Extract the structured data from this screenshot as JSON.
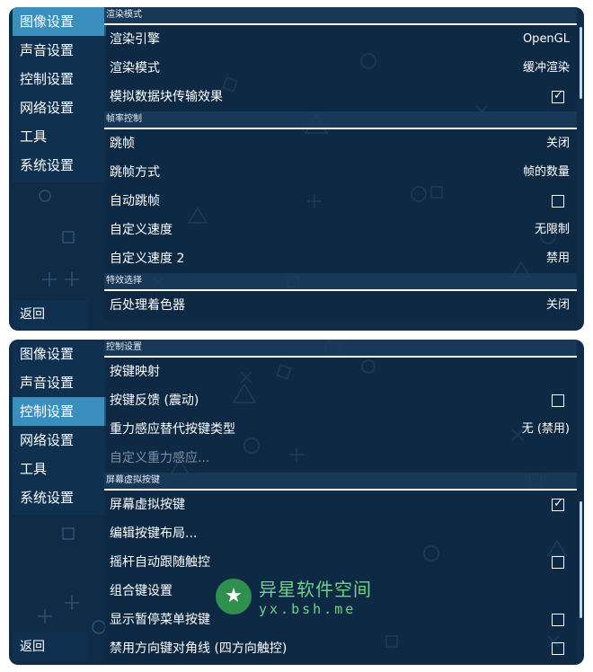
{
  "panel1": {
    "sidebar": [
      "图像设置",
      "声音设置",
      "控制设置",
      "网络设置",
      "工具",
      "系统设置"
    ],
    "active_index": 0,
    "back_label": "返回",
    "sections": [
      {
        "title": "渲染模式",
        "rows": [
          {
            "label": "渲染引擎",
            "value": "OpenGL"
          },
          {
            "label": "渲染模式",
            "value": "缓冲渲染"
          },
          {
            "label": "模拟数据块传输效果",
            "checkbox": true
          }
        ]
      },
      {
        "title": "帧率控制",
        "rows": [
          {
            "label": "跳帧",
            "value": "关闭"
          },
          {
            "label": "跳帧方式",
            "value": "帧的数量"
          },
          {
            "label": "自动跳帧",
            "checkbox": false
          },
          {
            "label": "自定义速度",
            "value": "无限制"
          },
          {
            "label": "自定义速度 2",
            "value": "禁用"
          }
        ]
      },
      {
        "title": "特效选择",
        "rows": [
          {
            "label": "后处理着色器",
            "value": "关闭"
          }
        ]
      }
    ]
  },
  "panel2": {
    "sidebar": [
      "图像设置",
      "声音设置",
      "控制设置",
      "网络设置",
      "工具",
      "系统设置"
    ],
    "active_index": 2,
    "back_label": "返回",
    "sections": [
      {
        "title": "控制设置",
        "rows": [
          {
            "label": "按键映射"
          },
          {
            "label": "按键反馈 (震动)",
            "checkbox": false
          },
          {
            "label": "重力感应替代按键类型",
            "value": "无 (禁用)"
          },
          {
            "label": "自定义重力感应...",
            "disabled": true
          }
        ]
      },
      {
        "title": "屏幕虚拟按键",
        "rows": [
          {
            "label": "屏幕虚拟按键",
            "checkbox": true
          },
          {
            "label": "编辑按键布局..."
          },
          {
            "label": "摇杆自动跟随触控",
            "checkbox": false
          },
          {
            "label": "组合键设置"
          },
          {
            "label": "显示暂停菜单按键",
            "checkbox": false
          },
          {
            "label": "禁用方向键对角线 (四方向触控)",
            "checkbox": false
          }
        ]
      }
    ]
  },
  "watermark": {
    "title": "异星软件空间",
    "url": "yx.bsh.me",
    "icon": "star-icon"
  },
  "colors": {
    "panel_bg": "#0f2b46",
    "active_tab": "#3a8fbf",
    "watermark": "#6fd28a"
  }
}
